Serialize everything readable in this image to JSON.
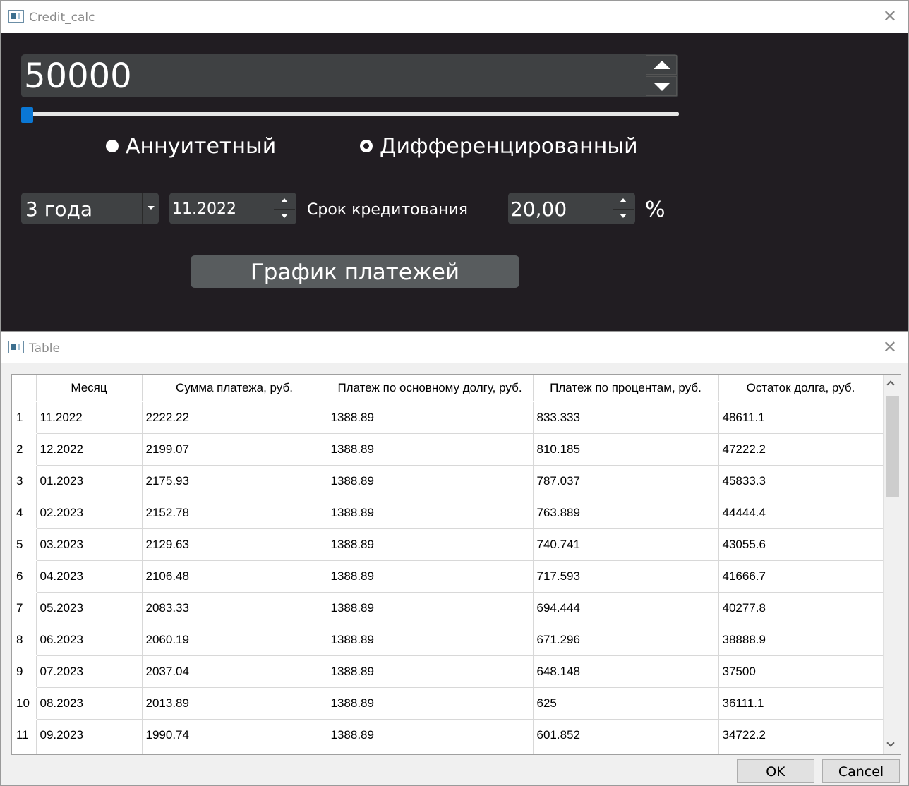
{
  "calc_window": {
    "title": "Credit_calc",
    "amount": "50000",
    "slider_fraction": 0.0,
    "payment_types": [
      {
        "label": "Аннуитетный",
        "selected": true
      },
      {
        "label": "Дифференцированный",
        "selected": false
      }
    ],
    "term_value": "3 года",
    "start_date": "11.2022",
    "term_label": "Срок кредитования",
    "rate_value": "20,00",
    "rate_unit": "%",
    "schedule_button": "График платежей",
    "accent_color": "#0a77d5"
  },
  "table_window": {
    "title": "Table",
    "columns": [
      "Месяц",
      "Сумма платежа, руб.",
      "Платеж по основному долгу, руб.",
      "Платеж по процентам, руб.",
      "Остаток долга, руб."
    ],
    "rows": [
      {
        "n": "1",
        "cells": [
          "11.2022",
          "2222.22",
          "1388.89",
          "833.333",
          "48611.1"
        ]
      },
      {
        "n": "2",
        "cells": [
          "12.2022",
          "2199.07",
          "1388.89",
          "810.185",
          "47222.2"
        ]
      },
      {
        "n": "3",
        "cells": [
          "01.2023",
          "2175.93",
          "1388.89",
          "787.037",
          "45833.3"
        ]
      },
      {
        "n": "4",
        "cells": [
          "02.2023",
          "2152.78",
          "1388.89",
          "763.889",
          "44444.4"
        ]
      },
      {
        "n": "5",
        "cells": [
          "03.2023",
          "2129.63",
          "1388.89",
          "740.741",
          "43055.6"
        ]
      },
      {
        "n": "6",
        "cells": [
          "04.2023",
          "2106.48",
          "1388.89",
          "717.593",
          "41666.7"
        ]
      },
      {
        "n": "7",
        "cells": [
          "05.2023",
          "2083.33",
          "1388.89",
          "694.444",
          "40277.8"
        ]
      },
      {
        "n": "8",
        "cells": [
          "06.2023",
          "2060.19",
          "1388.89",
          "671.296",
          "38888.9"
        ]
      },
      {
        "n": "9",
        "cells": [
          "07.2023",
          "2037.04",
          "1388.89",
          "648.148",
          "37500"
        ]
      },
      {
        "n": "10",
        "cells": [
          "08.2023",
          "2013.89",
          "1388.89",
          "625",
          "36111.1"
        ]
      },
      {
        "n": "11",
        "cells": [
          "09.2023",
          "1990.74",
          "1388.89",
          "601.852",
          "34722.2"
        ]
      },
      {
        "n": "",
        "cells": [
          "",
          "",
          "",
          "",
          ""
        ]
      }
    ],
    "ok_button": "OK",
    "cancel_button": "Cancel"
  }
}
